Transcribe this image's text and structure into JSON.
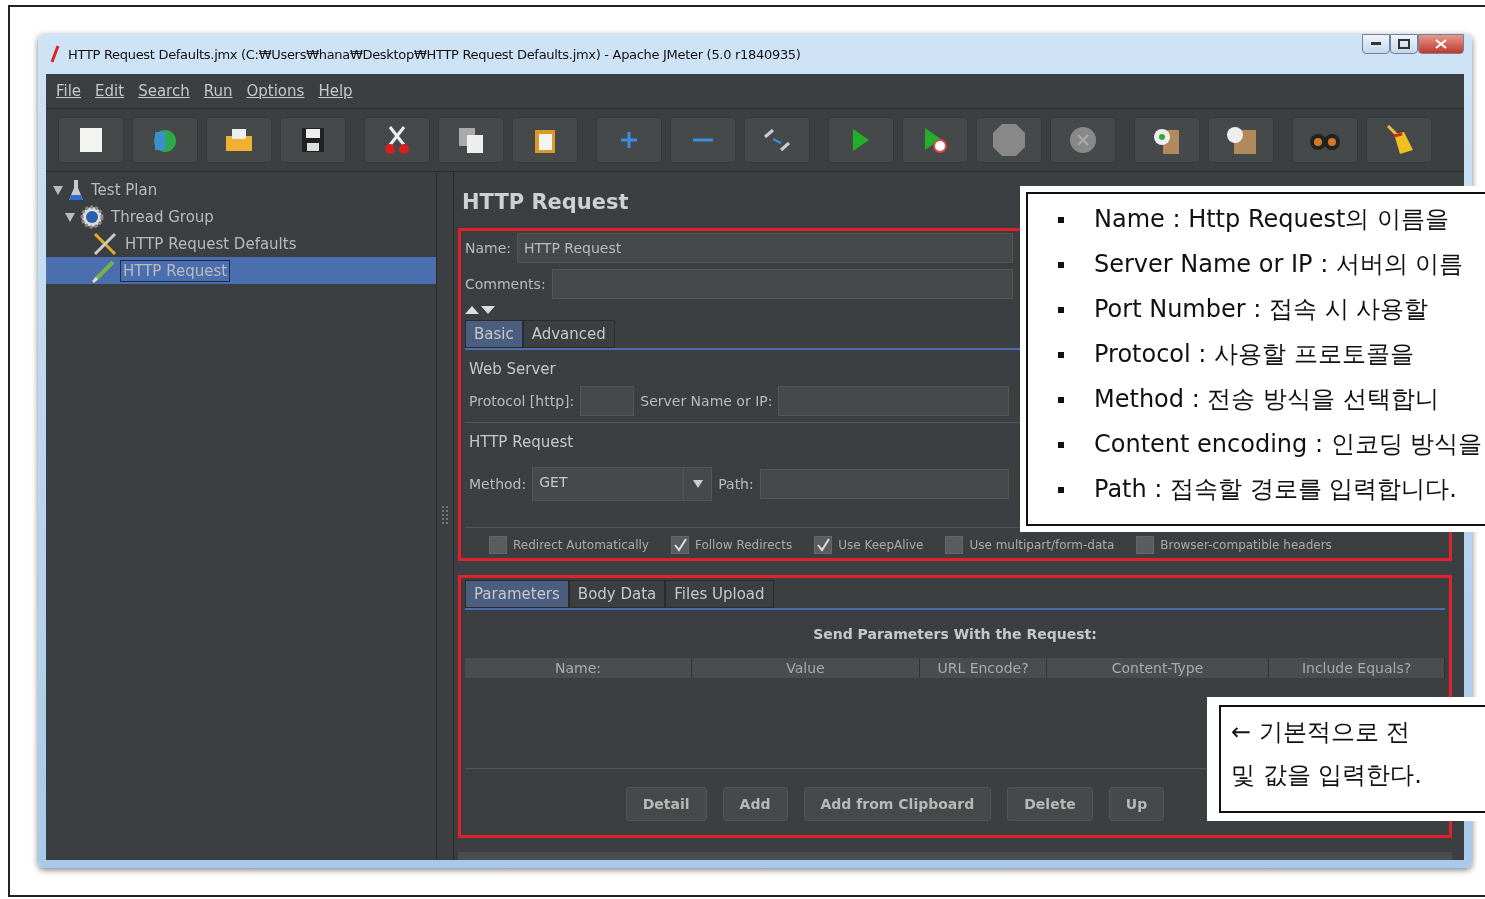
{
  "window": {
    "title": "HTTP Request Defaults.jmx (C:₩Users₩hana₩Desktop₩HTTP Request Defaults.jmx) - Apache JMeter (5.0 r1840935)"
  },
  "menu": [
    "File",
    "Edit",
    "Search",
    "Run",
    "Options",
    "Help"
  ],
  "tree": [
    {
      "label": "Test Plan",
      "kind": "plan",
      "expanded": true,
      "selected": false,
      "children": [
        {
          "label": "Thread Group",
          "kind": "group",
          "expanded": true,
          "selected": false,
          "children": [
            {
              "label": "HTTP Request Defaults",
              "kind": "config",
              "selected": false
            },
            {
              "label": "HTTP Request",
              "kind": "sampler",
              "selected": true
            }
          ]
        }
      ]
    }
  ],
  "panel": {
    "title": "HTTP Request",
    "name_label": "Name:",
    "name_value": "HTTP Request",
    "comments_label": "Comments:",
    "tabs": [
      {
        "label": "Basic",
        "selected": true
      },
      {
        "label": "Advanced",
        "selected": false
      }
    ],
    "web_server": {
      "legend": "Web Server",
      "protocol_label": "Protocol [http]:",
      "server_label": "Server Name or IP:"
    },
    "http_request": {
      "legend": "HTTP Request",
      "method_label": "Method:",
      "method_value": "GET",
      "path_label": "Path:"
    },
    "options": [
      {
        "label": "Redirect Automatically",
        "checked": false
      },
      {
        "label": "Follow Redirects",
        "checked": true
      },
      {
        "label": "Use KeepAlive",
        "checked": true
      },
      {
        "label": "Use multipart/form-data",
        "checked": false
      },
      {
        "label": "Browser-compatible headers",
        "checked": false
      }
    ],
    "param_tabs": [
      {
        "label": "Parameters",
        "selected": true
      },
      {
        "label": "Body Data",
        "selected": false
      },
      {
        "label": "Files Upload",
        "selected": false
      }
    ],
    "params_caption": "Send Parameters With the Request:",
    "columns": [
      "Name:",
      "Value",
      "URL Encode?",
      "Content-Type",
      "Include Equals?"
    ],
    "buttons": [
      "Detail",
      "Add",
      "Add from Clipboard",
      "Delete",
      "Up"
    ]
  },
  "notes": [
    "Name : Http Request의 이름을",
    "Server Name or IP : 서버의 이름",
    "Port Number : 접속 시 사용할",
    "Protocol : 사용할 프로토콜을",
    "Method : 전송 방식을 선택합니",
    "Content encoding : 인코딩 방식을",
    "Path : 접속할 경로를 입력합니다."
  ],
  "note2": [
    "← 기본적으로 전",
    "및 값을 입력한다."
  ]
}
